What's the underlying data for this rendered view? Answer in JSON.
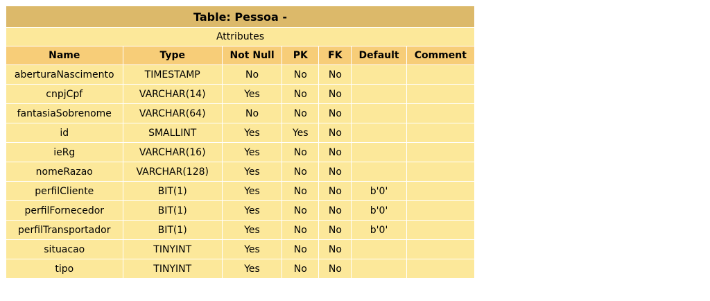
{
  "table": {
    "title": "Table: Pessoa -",
    "section_label": "Attributes",
    "columns": [
      "Name",
      "Type",
      "Not Null",
      "PK",
      "FK",
      "Default",
      "Comment"
    ],
    "rows": [
      [
        "aberturaNascimento",
        "TIMESTAMP",
        "No",
        "No",
        "No",
        "",
        ""
      ],
      [
        "cnpjCpf",
        "VARCHAR(14)",
        "Yes",
        "No",
        "No",
        "",
        ""
      ],
      [
        "fantasiaSobrenome",
        "VARCHAR(64)",
        "No",
        "No",
        "No",
        "",
        ""
      ],
      [
        "id",
        "SMALLINT",
        "Yes",
        "Yes",
        "No",
        "",
        ""
      ],
      [
        "ieRg",
        "VARCHAR(16)",
        "Yes",
        "No",
        "No",
        "",
        ""
      ],
      [
        "nomeRazao",
        "VARCHAR(128)",
        "Yes",
        "No",
        "No",
        "",
        ""
      ],
      [
        "perfilCliente",
        "BIT(1)",
        "Yes",
        "No",
        "No",
        "b'0'",
        ""
      ],
      [
        "perfilFornecedor",
        "BIT(1)",
        "Yes",
        "No",
        "No",
        "b'0'",
        ""
      ],
      [
        "perfilTransportador",
        "BIT(1)",
        "Yes",
        "No",
        "No",
        "b'0'",
        ""
      ],
      [
        "situacao",
        "TINYINT",
        "Yes",
        "No",
        "No",
        "",
        ""
      ],
      [
        "tipo",
        "TINYINT",
        "Yes",
        "No",
        "No",
        "",
        ""
      ]
    ]
  }
}
